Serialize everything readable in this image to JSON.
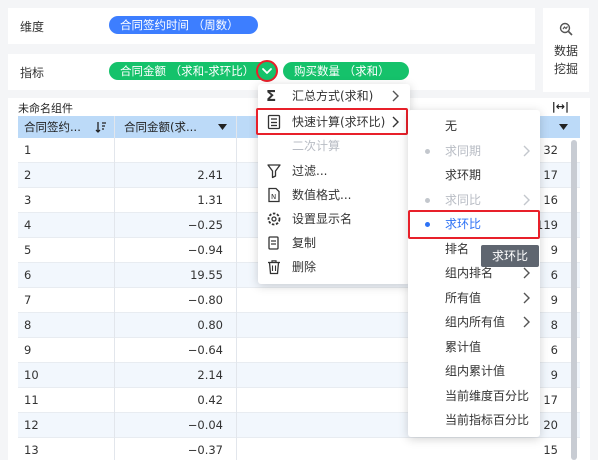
{
  "dimension": {
    "label": "维度",
    "pill": "合同签约时间 （周数）"
  },
  "metric": {
    "label": "指标",
    "pill1": "合同金额 （求和-求环比）",
    "pill2": "购买数量 （求和）"
  },
  "mining": {
    "line1": "数据",
    "line2": "挖掘"
  },
  "widget": {
    "title": "未命名组件"
  },
  "table": {
    "headers": {
      "col1": "合同签约...",
      "col2": "合同金额(求..."
    },
    "rows": [
      {
        "c1": "1",
        "c2": "",
        "c3": "32"
      },
      {
        "c1": "2",
        "c2": "2.41",
        "c3": "17"
      },
      {
        "c1": "3",
        "c2": "1.31",
        "c3": "16"
      },
      {
        "c1": "4",
        "c2": "−0.25",
        "c3": "119"
      },
      {
        "c1": "5",
        "c2": "−0.94",
        "c3": "9"
      },
      {
        "c1": "6",
        "c2": "19.55",
        "c3": "6"
      },
      {
        "c1": "7",
        "c2": "−0.80",
        "c3": "9"
      },
      {
        "c1": "8",
        "c2": "0.80",
        "c3": "8"
      },
      {
        "c1": "9",
        "c2": "−0.64",
        "c3": "6"
      },
      {
        "c1": "10",
        "c2": "2.14",
        "c3": "9"
      },
      {
        "c1": "11",
        "c2": "0.42",
        "c3": "17"
      },
      {
        "c1": "12",
        "c2": "−0.04",
        "c3": "20"
      },
      {
        "c1": "13",
        "c2": "−0.37",
        "c3": "15"
      }
    ]
  },
  "context_menu": {
    "items": [
      {
        "label": "汇总方式(求和)"
      },
      {
        "label": "快速计算(求环比)"
      },
      {
        "label": "二次计算"
      },
      {
        "label": "过滤..."
      },
      {
        "label": "数值格式..."
      },
      {
        "label": "设置显示名"
      },
      {
        "label": "复制"
      },
      {
        "label": "删除"
      }
    ]
  },
  "sub_menu": {
    "items": [
      {
        "label": "无"
      },
      {
        "label": "求同期"
      },
      {
        "label": "求环期"
      },
      {
        "label": "求同比"
      },
      {
        "label": "求环比"
      },
      {
        "label": "排名"
      },
      {
        "label": "组内排名"
      },
      {
        "label": "所有值"
      },
      {
        "label": "组内所有值"
      },
      {
        "label": "累计值"
      },
      {
        "label": "组内累计值"
      },
      {
        "label": "当前维度百分比"
      },
      {
        "label": "当前指标百分比"
      }
    ]
  },
  "tooltip": {
    "text": "求环比"
  },
  "colors": {
    "accent_blue": "#3d7eff",
    "accent_green": "#15c26b",
    "highlight_red": "#e8202a",
    "header_bg": "#bcdaf8"
  }
}
